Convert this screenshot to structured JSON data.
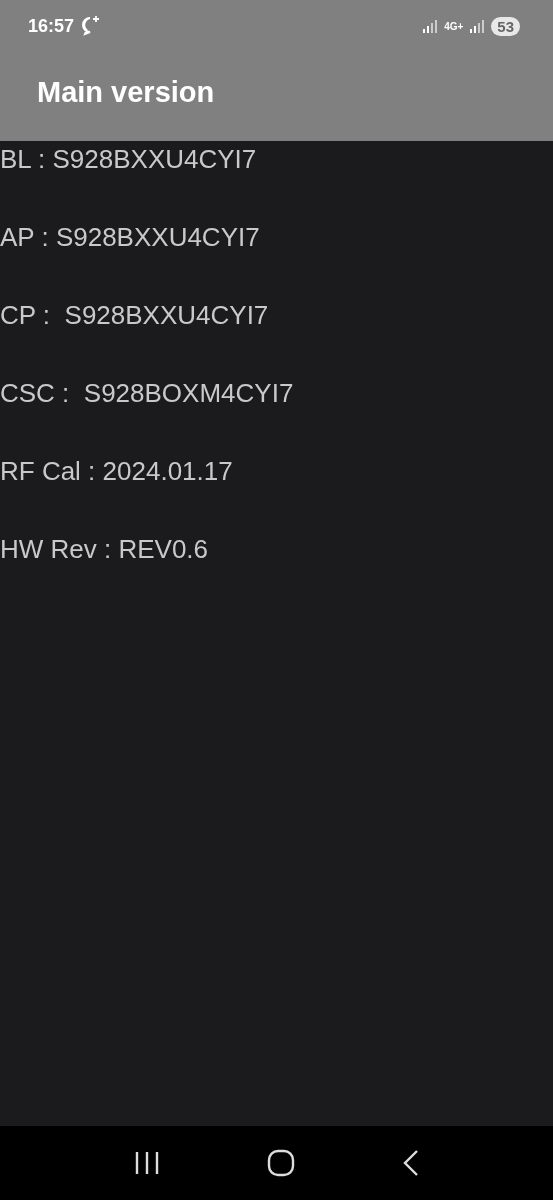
{
  "status_bar": {
    "time": "16:57",
    "network": "4G+",
    "battery": "53"
  },
  "header": {
    "title": "Main version"
  },
  "lines": [
    "BL : S928BXXU4CYI7",
    "AP : S928BXXU4CYI7",
    "CP :  S928BXXU4CYI7",
    "CSC :  S928BOXM4CYI7",
    "RF Cal : 2024.01.17",
    "HW Rev : REV0.6"
  ]
}
